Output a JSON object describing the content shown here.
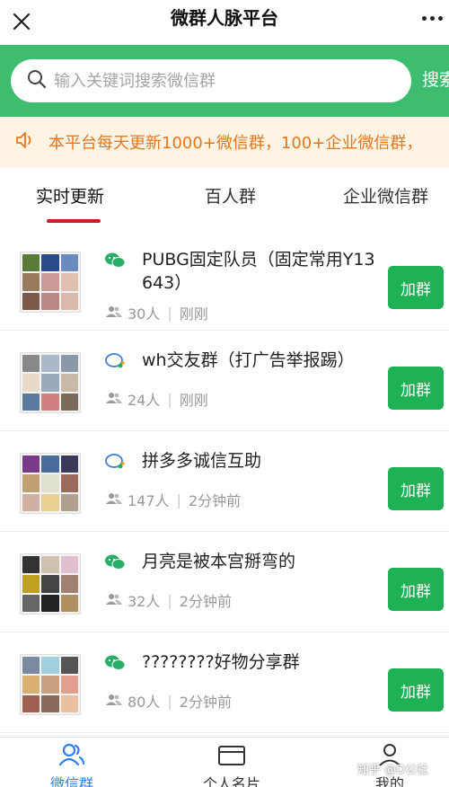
{
  "header": {
    "title": "微群人脉平台"
  },
  "search": {
    "placeholder": "输入关键词搜索微信群",
    "button_label": "搜索"
  },
  "notice": {
    "text": "本平台每天更新1000+微信群，100+企业微信群，"
  },
  "tabs": [
    {
      "label": "实时更新",
      "active": true
    },
    {
      "label": "百人群",
      "active": false
    },
    {
      "label": "企业微信群",
      "active": false
    }
  ],
  "groups": [
    {
      "title": "PUBG固定队员（固定常用Y13643）",
      "icon": "wechat-icon",
      "members": "30人",
      "time": "刚刚",
      "button": "加群"
    },
    {
      "title": "wh交友群（打广告举报踢）",
      "icon": "wecom-icon",
      "members": "24人",
      "time": "刚刚",
      "button": "加群"
    },
    {
      "title": "拼多多诚信互助",
      "icon": "wecom-icon",
      "members": "147人",
      "time": "2分钟前",
      "button": "加群"
    },
    {
      "title": "月亮是被本宫掰弯的",
      "icon": "wechat-icon",
      "members": "32人",
      "time": "2分钟前",
      "button": "加群"
    },
    {
      "title": "????????好物分享群",
      "icon": "wechat-icon",
      "members": "80人",
      "time": "2分钟前",
      "button": "加群"
    }
  ],
  "bottom_nav": [
    {
      "label": "微信群",
      "icon": "people-icon",
      "active": true
    },
    {
      "label": "个人名片",
      "icon": "card-icon",
      "active": false
    },
    {
      "label": "我的",
      "icon": "user-icon",
      "active": false
    }
  ],
  "watermark": "知乎 @D公社",
  "colors": {
    "brand_green": "#3ebd70",
    "button_green": "#1fb255",
    "notice_orange": "#e8761e",
    "tab_underline": "#c4202a",
    "nav_active_blue": "#2f7ff0"
  }
}
